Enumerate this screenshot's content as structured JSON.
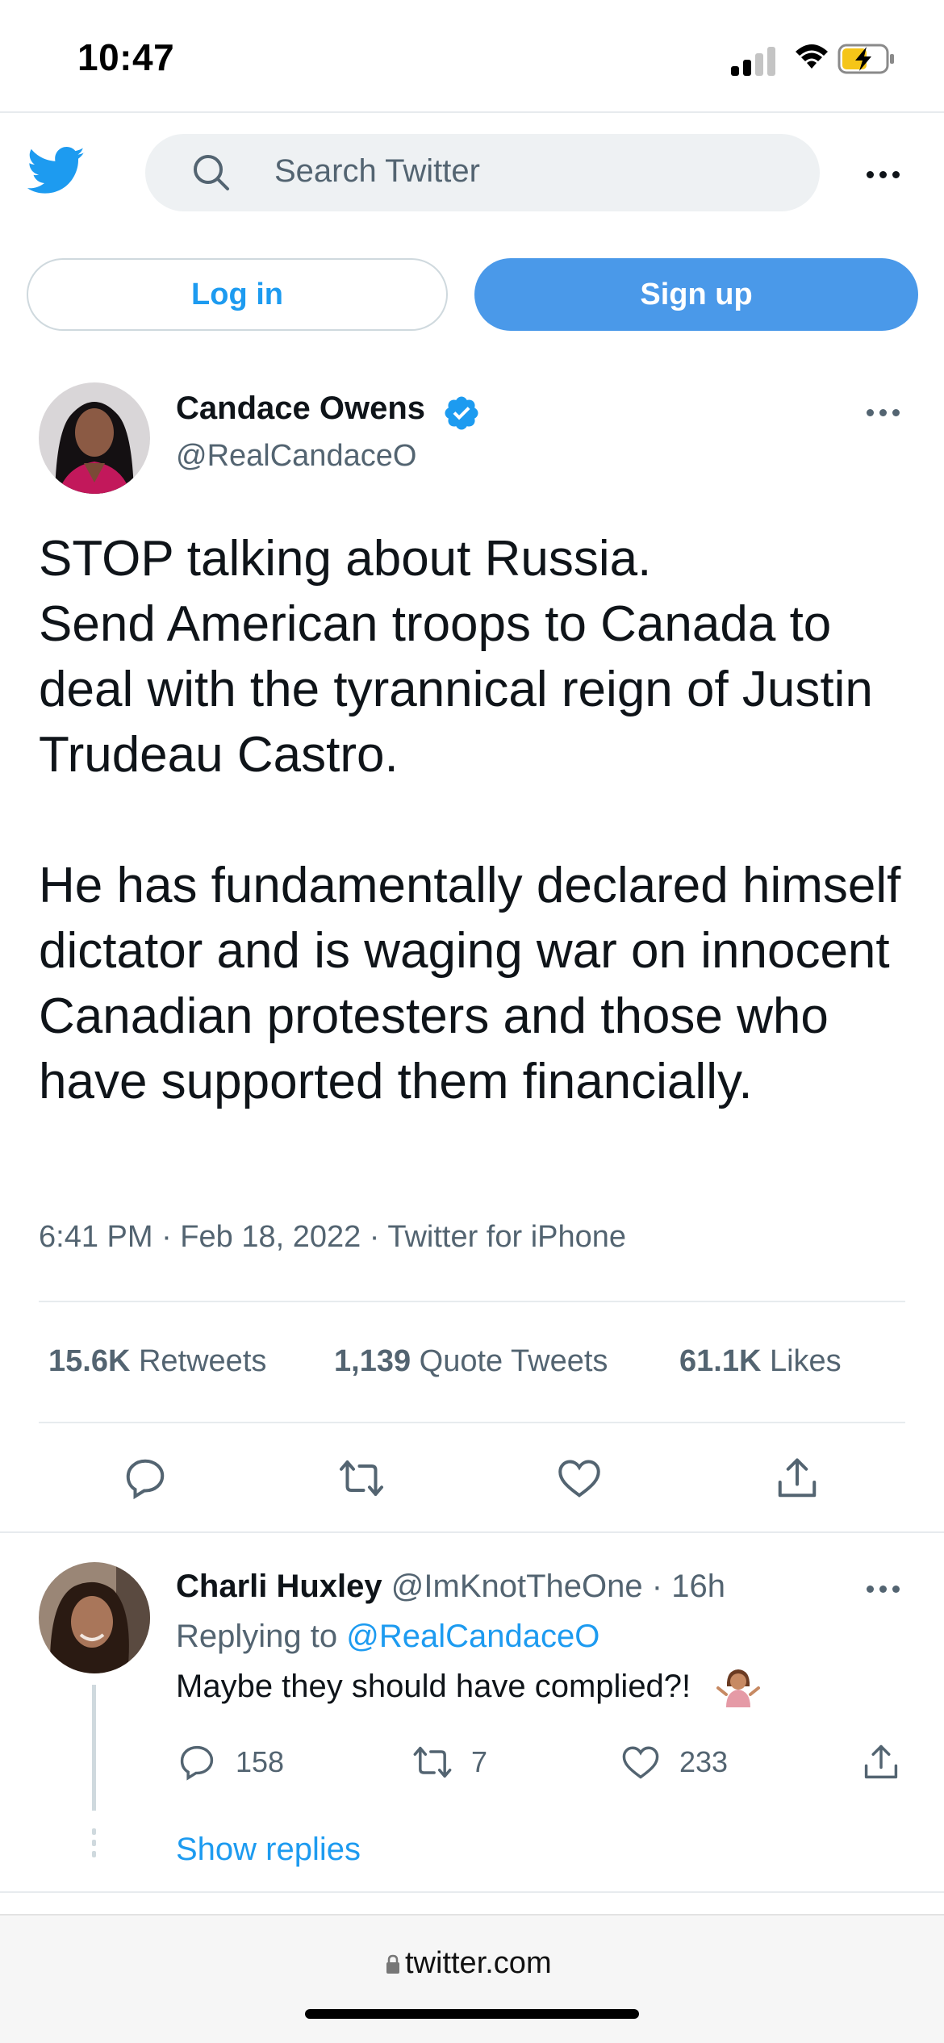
{
  "status_bar": {
    "time": "10:47"
  },
  "header": {
    "search_placeholder": "Search Twitter"
  },
  "auth": {
    "login_label": "Log in",
    "signup_label": "Sign up"
  },
  "tweet": {
    "author_name": "Candace Owens",
    "author_handle": "@RealCandaceO",
    "text": "STOP talking about Russia.\nSend American troops to Canada to deal with the tyrannical reign of Justin Trudeau Castro.\n\nHe has fundamentally declared himself dictator and is waging war on innocent Canadian protesters and those who have supported them financially.",
    "meta": "6:41 PM · Feb 18, 2022 · Twitter for iPhone",
    "stats": {
      "retweets_count": "15.6K",
      "retweets_label": "Retweets",
      "quotes_count": "1,139",
      "quotes_label": "Quote Tweets",
      "likes_count": "61.1K",
      "likes_label": "Likes"
    }
  },
  "reply": {
    "author_name": "Charli Huxley",
    "author_handle": "@ImKnotTheOne",
    "time": "· 16h",
    "replying_prefix": "Replying to",
    "replying_handle": "@RealCandaceO",
    "text": "Maybe they should have complied?!",
    "reply_count": "158",
    "retweet_count": "7",
    "like_count": "233",
    "show_replies": "Show replies"
  },
  "browser": {
    "url": "twitter.com"
  },
  "colors": {
    "brand": "#1d9bf0",
    "signup": "#4a99e9",
    "text": "#0f1419",
    "secondary": "#536471"
  },
  "icons": [
    "twitter-bird-icon",
    "search-icon",
    "more-icon",
    "verified-badge-icon",
    "reply-icon",
    "retweet-icon",
    "like-icon",
    "share-icon",
    "lock-icon"
  ]
}
